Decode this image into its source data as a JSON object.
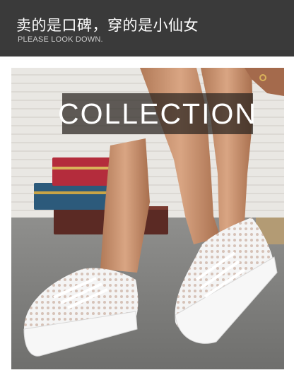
{
  "header": {
    "title": "卖的是口碑，穿的是小仙女",
    "subtitle": "PLEASE LOOK DOWN."
  },
  "banner": {
    "text": "COLLECTION"
  },
  "colors": {
    "header_bg": "#3a3a3a",
    "banner_bg": "#28221e",
    "shoe": "#ffffff"
  }
}
